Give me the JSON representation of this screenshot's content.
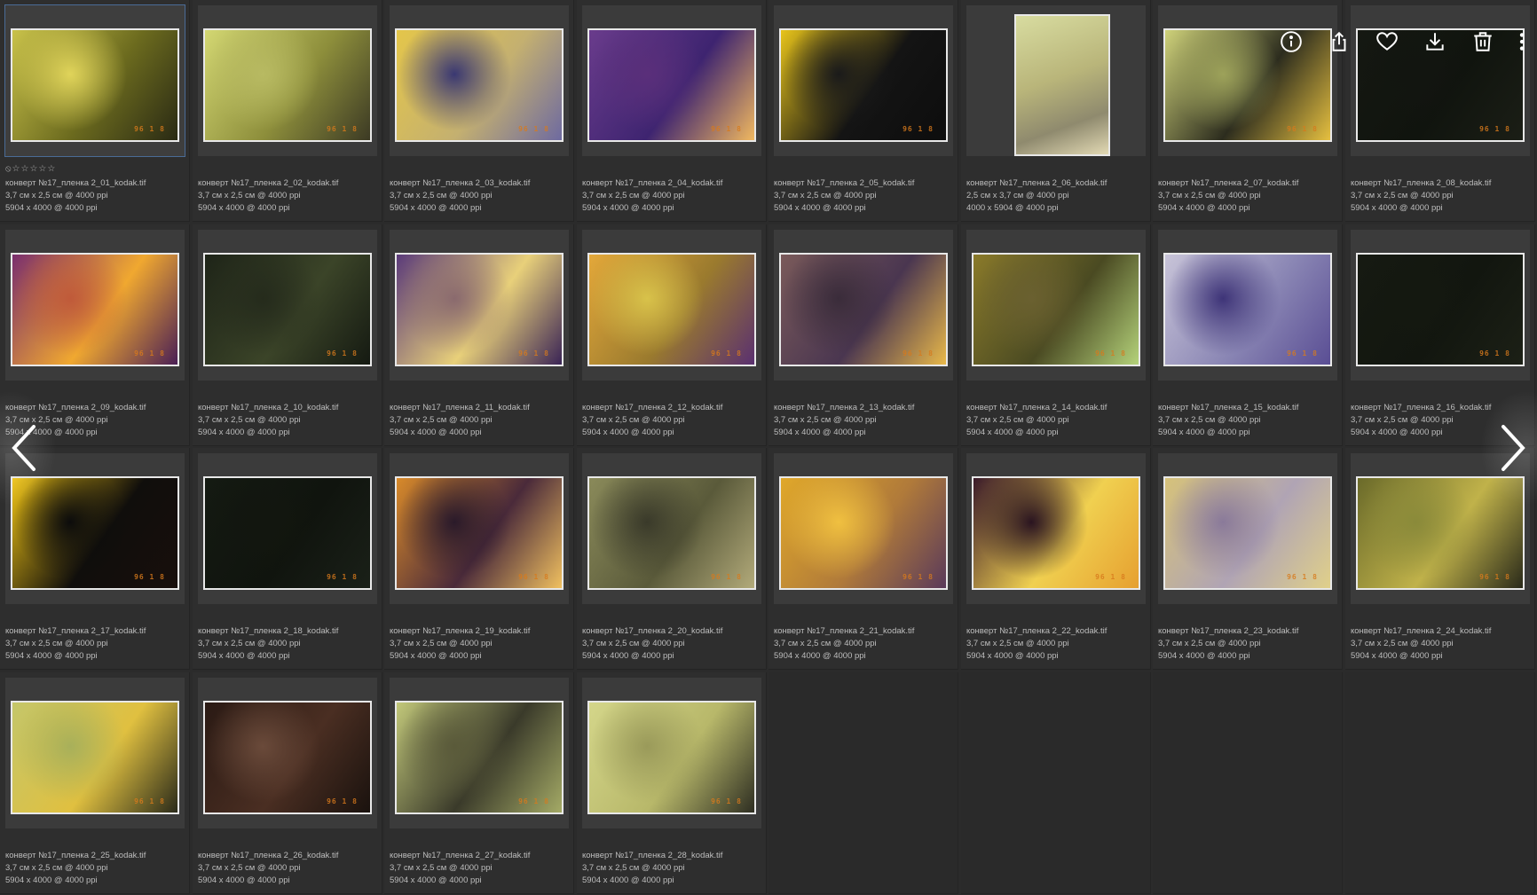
{
  "gallery": {
    "rating_row": "⦸☆☆☆☆☆",
    "thumb_stamp": "96 1 8",
    "items": [
      {
        "filename": "конверт №17_пленка 2_01_kodak.tif",
        "print_size": "3,7 см x 2,5 см @ 4000 ppi",
        "pixel_size": "5904 x 4000 @ 4000 ppi",
        "orientation": "landscape",
        "palette": [
          "#c9c24a",
          "#6b6a1e",
          "#2a2a14",
          "#e0d45a"
        ],
        "selected": true
      },
      {
        "filename": "конверт №17_пленка 2_02_kodak.tif",
        "print_size": "3,7 см x 2,5 см @ 4000 ppi",
        "pixel_size": "5904 x 4000 @ 4000 ppi",
        "orientation": "landscape",
        "palette": [
          "#d3d772",
          "#8d8e3b",
          "#3c3a24",
          "#b8ba62"
        ]
      },
      {
        "filename": "конверт №17_пленка 2_03_kodak.tif",
        "print_size": "3,7 см x 2,5 см @ 4000 ppi",
        "pixel_size": "5904 x 4000 @ 4000 ppi",
        "orientation": "landscape",
        "palette": [
          "#e4c64a",
          "#c4b070",
          "#6e6aa0",
          "#3a3872"
        ]
      },
      {
        "filename": "конверт №17_пленка 2_04_kodak.tif",
        "print_size": "3,7 см x 2,5 см @ 4000 ppi",
        "pixel_size": "5904 x 4000 @ 4000 ppi",
        "orientation": "landscape",
        "palette": [
          "#6a3c8c",
          "#3e2470",
          "#f0b860",
          "#5a2f7a"
        ]
      },
      {
        "filename": "конверт №17_пленка 2_05_kodak.tif",
        "print_size": "3,7 см x 2,5 см @ 4000 ppi",
        "pixel_size": "5904 x 4000 @ 4000 ppi",
        "orientation": "landscape",
        "palette": [
          "#e8c41a",
          "#141414",
          "#0d0d0d",
          "#1a1a1a"
        ]
      },
      {
        "filename": "конверт №17_пленка 2_06_kodak.tif",
        "print_size": "2,5 см x 3,7 см @ 4000 ppi",
        "pixel_size": "4000 x 5904 @ 4000 ppi",
        "orientation": "portrait",
        "palette": [
          "#d8dca0",
          "#b9b57a",
          "#8f8a6e",
          "#e2d9b4"
        ]
      },
      {
        "filename": "конверт №17_пленка 2_07_kodak.tif",
        "print_size": "3,7 см x 2,5 см @ 4000 ppi",
        "pixel_size": "5904 x 4000 @ 4000 ppi",
        "orientation": "landscape",
        "palette": [
          "#cfd27a",
          "#2c2c1e",
          "#e6c040",
          "#9da25a"
        ]
      },
      {
        "filename": "конверт №17_пленка 2_08_kodak.tif",
        "print_size": "3,7 см x 2,5 см @ 4000 ppi",
        "pixel_size": "5904 x 4000 @ 4000 ppi",
        "orientation": "landscape",
        "palette": [
          "#151812",
          "#10140e",
          "#1b1e16",
          "#121510"
        ]
      },
      {
        "filename": "конверт №17_пленка 2_09_kodak.tif",
        "print_size": "3,7 см x 2,5 см @ 4000 ppi",
        "pixel_size": "5904 x 4000 @ 4000 ppi",
        "orientation": "landscape",
        "palette": [
          "#7a2e6e",
          "#f0a830",
          "#4a1f55",
          "#c05a3a"
        ]
      },
      {
        "filename": "конверт №17_пленка 2_10_kodak.tif",
        "print_size": "3,7 см x 2,5 см @ 4000 ppi",
        "pixel_size": "5904 x 4000 @ 4000 ppi",
        "orientation": "landscape",
        "palette": [
          "#1e2418",
          "#3b4428",
          "#151a12",
          "#252b1c"
        ]
      },
      {
        "filename": "конверт №17_пленка 2_11_kodak.tif",
        "print_size": "3,7 см x 2,5 см @ 4000 ppi",
        "pixel_size": "5904 x 4000 @ 4000 ppi",
        "orientation": "landscape",
        "palette": [
          "#5a3a7a",
          "#e8d07a",
          "#3a2456",
          "#8a6a6e"
        ]
      },
      {
        "filename": "конверт №17_пленка 2_12_kodak.tif",
        "print_size": "3,7 см x 2,5 см @ 4000 ppi",
        "pixel_size": "5904 x 4000 @ 4000 ppi",
        "orientation": "landscape",
        "palette": [
          "#e3a83a",
          "#9a7a2e",
          "#5a3070",
          "#d8c24a"
        ]
      },
      {
        "filename": "конверт №17_пленка 2_13_kodak.tif",
        "print_size": "3,7 см x 2,5 см @ 4000 ppi",
        "pixel_size": "5904 x 4000 @ 4000 ppi",
        "orientation": "landscape",
        "palette": [
          "#7a5a5a",
          "#4a3650",
          "#e8b84a",
          "#3a2c3a"
        ]
      },
      {
        "filename": "конверт №17_пленка 2_14_kodak.tif",
        "print_size": "3,7 см x 2,5 см @ 4000 ppi",
        "pixel_size": "5904 x 4000 @ 4000 ppi",
        "orientation": "landscape",
        "palette": [
          "#8a7a2a",
          "#4a4a22",
          "#b4d27a",
          "#6a6030"
        ]
      },
      {
        "filename": "конверт №17_пленка 2_15_kodak.tif",
        "print_size": "3,7 см x 2,5 см @ 4000 ppi",
        "pixel_size": "5904 x 4000 @ 4000 ppi",
        "orientation": "landscape",
        "palette": [
          "#c8c4d8",
          "#8a86b4",
          "#5a4e94",
          "#3e3478"
        ]
      },
      {
        "filename": "конверт №17_пленка 2_16_kodak.tif",
        "print_size": "3,7 см x 2,5 см @ 4000 ppi",
        "pixel_size": "5904 x 4000 @ 4000 ppi",
        "orientation": "landscape",
        "palette": [
          "#161a12",
          "#12160f",
          "#1c2016",
          "#141810"
        ]
      },
      {
        "filename": "конверт №17_пленка 2_17_kodak.tif",
        "print_size": "3,7 см x 2,5 см @ 4000 ppi",
        "pixel_size": "5904 x 4000 @ 4000 ppi",
        "orientation": "landscape",
        "palette": [
          "#f0c414",
          "#100e0c",
          "#180f0c",
          "#0c0c0c"
        ]
      },
      {
        "filename": "конверт №17_пленка 2_18_kodak.tif",
        "print_size": "3,7 см x 2,5 см @ 4000 ppi",
        "pixel_size": "5904 x 4000 @ 4000 ppi",
        "orientation": "landscape",
        "palette": [
          "#141a12",
          "#10140e",
          "#1a2018",
          "#12160f"
        ]
      },
      {
        "filename": "конверт №17_пленка 2_19_kodak.tif",
        "print_size": "3,7 см x 2,5 см @ 4000 ppi",
        "pixel_size": "5904 x 4000 @ 4000 ppi",
        "orientation": "landscape",
        "palette": [
          "#d88a2a",
          "#4a2a3a",
          "#f0c060",
          "#2a1a2a"
        ]
      },
      {
        "filename": "конверт №17_пленка 2_20_kodak.tif",
        "print_size": "3,7 см x 2,5 см @ 4000 ppi",
        "pixel_size": "5904 x 4000 @ 4000 ppi",
        "orientation": "landscape",
        "palette": [
          "#8a8a5a",
          "#5a5a3a",
          "#b2aa7a",
          "#3a3a2a"
        ]
      },
      {
        "filename": "конверт №17_пленка 2_21_kodak.tif",
        "print_size": "3,7 см x 2,5 см @ 4000 ppi",
        "pixel_size": "5904 x 4000 @ 4000 ppi",
        "orientation": "landscape",
        "palette": [
          "#e0a82a",
          "#b07a3a",
          "#5a3a5a",
          "#f0c040"
        ]
      },
      {
        "filename": "конверт №17_пленка 2_22_kodak.tif",
        "print_size": "3,7 см x 2,5 см @ 4000 ppi",
        "pixel_size": "5904 x 4000 @ 4000 ppi",
        "orientation": "landscape",
        "palette": [
          "#3a1a2a",
          "#f0d050",
          "#e6a030",
          "#2a1420"
        ]
      },
      {
        "filename": "конверт №17_пленка 2_23_kodak.tif",
        "print_size": "3,7 см x 2,5 см @ 4000 ppi",
        "pixel_size": "5904 x 4000 @ 4000 ppi",
        "orientation": "landscape",
        "palette": [
          "#d6c27a",
          "#b0a4b4",
          "#e0d08a",
          "#8a7a9a"
        ]
      },
      {
        "filename": "конверт №17_пленка 2_24_kodak.tif",
        "print_size": "3,7 см x 2,5 см @ 4000 ppi",
        "pixel_size": "5904 x 4000 @ 4000 ppi",
        "orientation": "landscape",
        "palette": [
          "#6a6a2a",
          "#c0b24a",
          "#2a2a1a",
          "#8a8a3a"
        ]
      },
      {
        "filename": "конверт №17_пленка 2_25_kodak.tif",
        "print_size": "3,7 см x 2,5 см @ 4000 ppi",
        "pixel_size": "5904 x 4000 @ 4000 ppi",
        "orientation": "landscape",
        "palette": [
          "#c4c66a",
          "#e0c040",
          "#2a2a1a",
          "#a8b05a"
        ]
      },
      {
        "filename": "конверт №17_пленка 2_26_kodak.tif",
        "print_size": "3,7 см x 2,5 см @ 4000 ppi",
        "pixel_size": "5904 x 4000 @ 4000 ppi",
        "orientation": "landscape",
        "palette": [
          "#2a1a14",
          "#4a2e22",
          "#1a120e",
          "#6a4a3a"
        ]
      },
      {
        "filename": "конверт №17_пленка 2_27_kodak.tif",
        "print_size": "3,7 см x 2,5 см @ 4000 ppi",
        "pixel_size": "5904 x 4000 @ 4000 ppi",
        "orientation": "landscape",
        "palette": [
          "#c2c87a",
          "#3a3a2a",
          "#a4aa66",
          "#5a5a3a"
        ]
      },
      {
        "filename": "конверт №17_пленка 2_28_kodak.tif",
        "print_size": "3,7 см x 2,5 см @ 4000 ppi",
        "pixel_size": "5904 x 4000 @ 4000 ppi",
        "orientation": "landscape",
        "palette": [
          "#d4d68a",
          "#b8b86a",
          "#2e2e22",
          "#9a9a5a"
        ]
      }
    ]
  },
  "toolbar": {
    "icons": [
      "info-icon",
      "share-icon",
      "heart-icon",
      "download-icon",
      "trash-icon",
      "more-vertical-icon"
    ],
    "icon_color": "#ffffff"
  },
  "navigation": {
    "prev_icon": "chevron-left-icon",
    "next_icon": "chevron-right-icon"
  }
}
